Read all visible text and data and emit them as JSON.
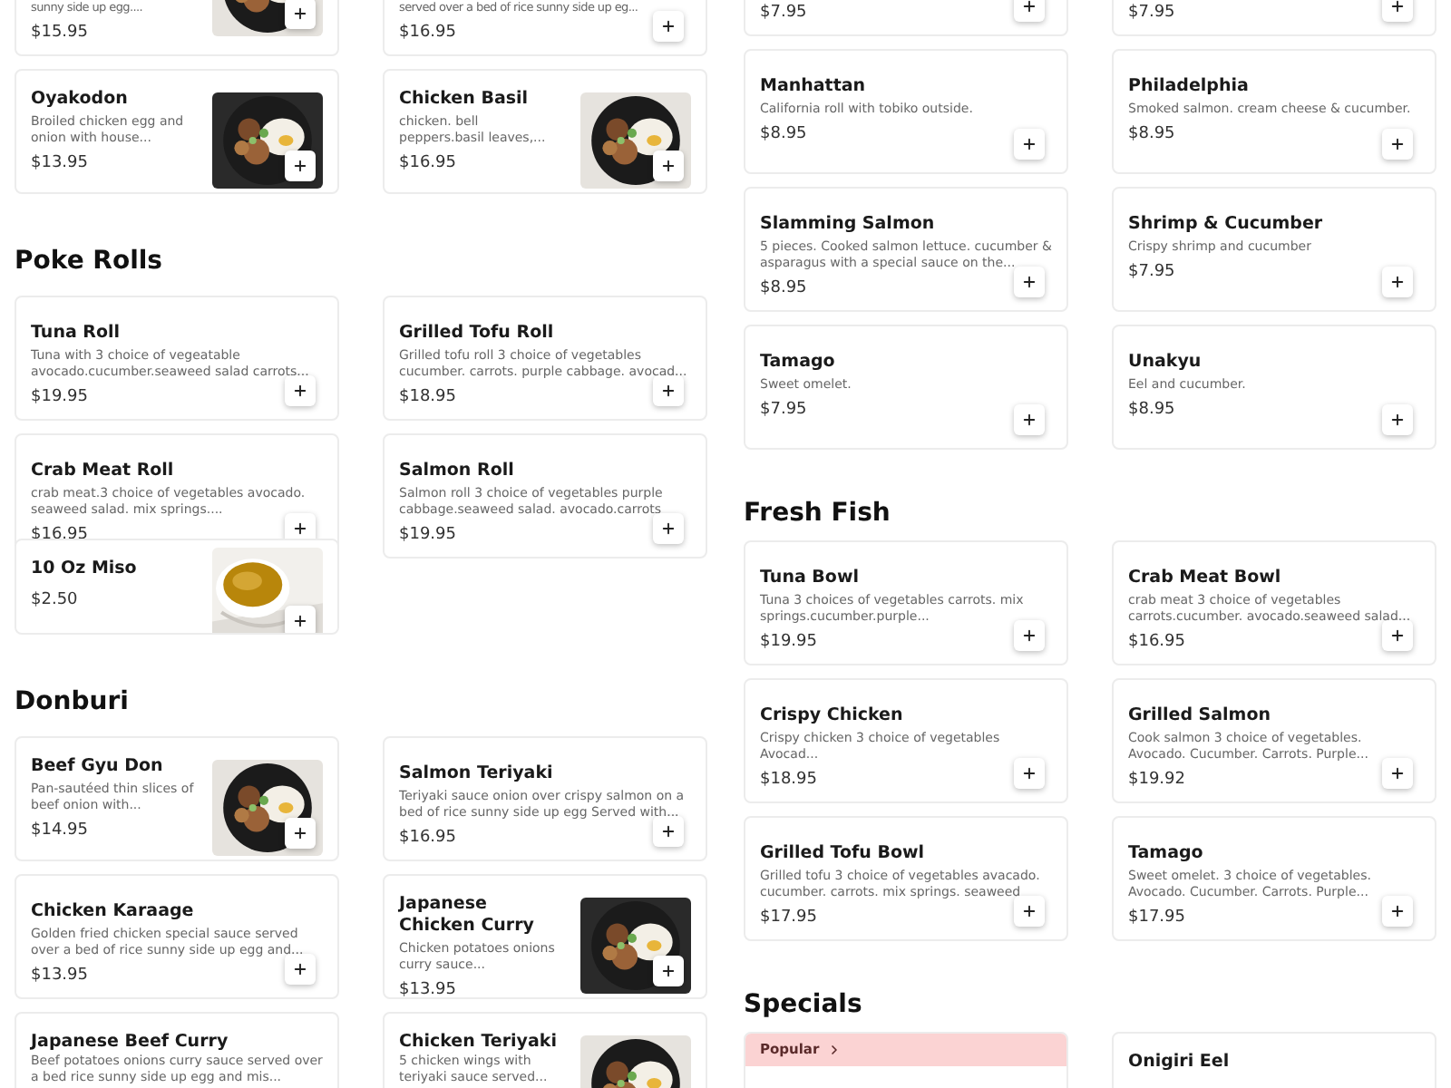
{
  "columns": [
    {
      "sections": [
        {
          "items": [
            {
              "description": "sunny side up egg....",
              "price": "$15.95",
              "picture": true
            },
            {
              "description": "served over a bed of rice sunny side up eg...",
              "price": "$16.95",
              "picture": false
            },
            {
              "name": "Oyakodon",
              "description": "Broiled chicken egg and onion with house...",
              "price": "$13.95",
              "picture": true
            },
            {
              "name": "Chicken Basil",
              "description": "chicken. bell peppers.basil leaves,...",
              "price": "$16.95",
              "picture": true
            }
          ]
        },
        {
          "heading": "Poke Rolls",
          "items": [
            {
              "name": "Tuna Roll",
              "description": "Tuna with 3 choice of vegeatable avocado.cucumber.seaweed salad carrots...",
              "price": "$19.95",
              "picture": false
            },
            {
              "name": "Grilled Tofu Roll",
              "description": "Grilled tofu roll 3 choice of vegetables cucumber. carrots. purple cabbage. avocad...",
              "price": "$18.95",
              "picture": false
            },
            {
              "name": "Crab Meat Roll",
              "description": "crab meat.3 choice of vegetables avocado. seaweed salad. mix springs....",
              "price": "$16.95",
              "picture": false
            },
            {
              "name": "Salmon Roll",
              "description": "Salmon roll 3 choice of vegetables purple cabbage.seaweed salad. avocado.carrots",
              "price": "$19.95",
              "picture": false
            },
            {
              "name": "10 Oz Miso",
              "price": "$2.50",
              "picture": true
            }
          ]
        },
        {
          "heading": "Donburi",
          "items": [
            {
              "name": "Beef Gyu Don",
              "description": "Pan-sautéed thin slices of beef onion with...",
              "price": "$14.95",
              "picture": true
            },
            {
              "name": "Salmon Teriyaki",
              "description": "Teriyaki sauce onion over crispy salmon on a bed of rice sunny side up egg Served with...",
              "price": "$16.95",
              "picture": false
            },
            {
              "name": "Chicken Karaage",
              "description": "Golden fried chicken special sauce served over a bed of rice sunny side up egg and...",
              "price": "$13.95",
              "picture": false
            },
            {
              "name": "Japanese Chicken Curry",
              "description": "Chicken potatoes onions curry sauce...",
              "price": "$13.95",
              "picture": true
            },
            {
              "name": "Japanese Beef Curry",
              "description": "Beef potatoes onions curry sauce served over a bed rice sunny side up egg and mis...",
              "picture": false
            },
            {
              "name": "Chicken Teriyaki",
              "description": "5 chicken wings with teriyaki sauce served...",
              "picture": true
            }
          ]
        }
      ]
    },
    {
      "sections": [
        {
          "items": [
            {
              "price": "$7.95",
              "picture": false
            },
            {
              "price": "$7.95",
              "picture": false
            },
            {
              "name": "Manhattan",
              "description": "California roll with tobiko outside.",
              "price": "$8.95",
              "picture": false
            },
            {
              "name": "Philadelphia",
              "description": "Smoked salmon. cream cheese & cucumber.",
              "price": "$8.95",
              "picture": false
            },
            {
              "name": "Slamming Salmon",
              "description": "5 pieces. Cooked salmon lettuce. cucumber & asparagus with a special sauce on the...",
              "price": "$8.95",
              "picture": false
            },
            {
              "name": "Shrimp & Cucumber",
              "description": "Crispy shrimp and cucumber",
              "price": "$7.95",
              "picture": false
            },
            {
              "name": "Tamago",
              "description": "Sweet omelet.",
              "price": "$7.95",
              "picture": false
            },
            {
              "name": "Unakyu",
              "description": "Eel and cucumber.",
              "price": "$8.95",
              "picture": false
            }
          ]
        },
        {
          "heading": "Fresh Fish",
          "items": [
            {
              "name": "Tuna Bowl",
              "description": "Tuna 3 choices of vegetables carrots. mix springs.cucumber.purple...",
              "price": "$19.95",
              "picture": false
            },
            {
              "name": "Crab Meat Bowl",
              "description": "crab meat 3 choice of vegetables carrots.cucumber. avocado.seaweed salad...",
              "price": "$16.95",
              "picture": false
            },
            {
              "name": "Crispy Chicken",
              "description": "Crispy chicken 3 choice of vegetables Avocad...",
              "price": "$18.95",
              "picture": false
            },
            {
              "name": "Grilled Salmon",
              "description": "Cook salmon 3 choice of vegetables. Avocado. Cucumber. Carrots. Purple...",
              "price": "$19.92",
              "picture": false
            },
            {
              "name": "Grilled Tofu Bowl",
              "description": "Grilled tofu 3 choice of vegetables avacado. cucumber. carrots. mix springs. seaweed",
              "price": "$17.95",
              "picture": false
            },
            {
              "name": "Tamago",
              "description": "Sweet omelet. 3 choice of vegetables. Avocado. Cucumber. Carrots. Purple...",
              "price": "$17.95",
              "picture": false
            }
          ]
        },
        {
          "heading": "Specials",
          "items": [
            {
              "kind": "category",
              "label": "Popular"
            },
            {
              "kind": "item",
              "name": "Onigiri Eel",
              "picture": false
            }
          ]
        }
      ]
    }
  ]
}
